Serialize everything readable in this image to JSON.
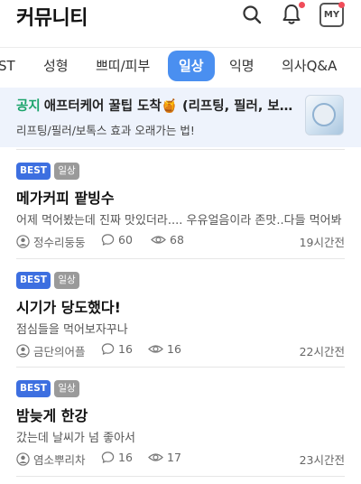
{
  "header": {
    "title": "커뮤니티",
    "my_label": "MY",
    "icons": [
      "search-icon",
      "bell-icon",
      "my-page-icon"
    ],
    "notification_dot_color": "#f04d5a"
  },
  "tabs": [
    {
      "label": "ST",
      "active": false
    },
    {
      "label": "성형",
      "active": false
    },
    {
      "label": "쁘띠/피부",
      "active": false
    },
    {
      "label": "일상",
      "active": true
    },
    {
      "label": "익명",
      "active": false
    },
    {
      "label": "의사Q&A",
      "active": false
    }
  ],
  "accent_color": "#4a8ff0",
  "notice": {
    "badge": "공지",
    "title": "애프터케어 꿀팁 도착🍯 (리프팅, 필러, 보톡스)",
    "subtitle": "리프팅/필러/보톡스 효과 오래가는 법!"
  },
  "posts": [
    {
      "badge_best": "BEST",
      "badge_category": "일상",
      "title": "메가커피 팥빙수",
      "body": "어제 먹어봤는데 진짜 맛있더라.... 우유얼음이라 존맛..다들 먹어봐",
      "author": "정수리둥둥",
      "comments": "60",
      "views": "68",
      "time": "19시간전"
    },
    {
      "badge_best": "BEST",
      "badge_category": "일상",
      "title": "시기가 당도했다!",
      "body": "점심들을 먹어보자꾸나",
      "author": "금단의어플",
      "comments": "16",
      "views": "16",
      "time": "22시간전"
    },
    {
      "badge_best": "BEST",
      "badge_category": "일상",
      "title": "밤늦게 한강",
      "body": "갔는데 날씨가 넘 좋아서",
      "author": "염소뿌리차",
      "comments": "16",
      "views": "17",
      "time": "23시간전"
    }
  ]
}
